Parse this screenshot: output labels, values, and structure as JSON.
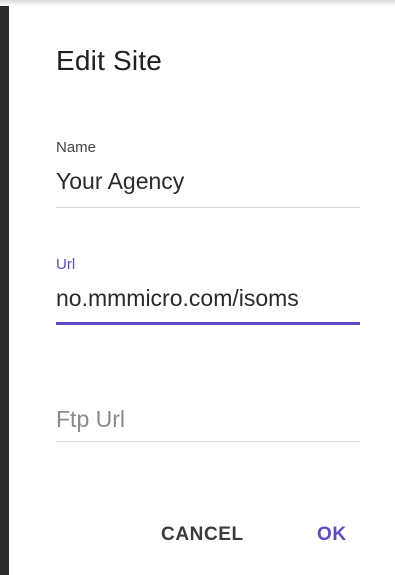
{
  "dialog": {
    "title": "Edit Site",
    "fields": {
      "name": {
        "label": "Name",
        "value": "Your Agency"
      },
      "url": {
        "label": "Url",
        "value": "no.mmmicro.com/isoms"
      },
      "ftp_url": {
        "placeholder": "Ftp Url",
        "value": ""
      }
    },
    "buttons": {
      "cancel": "CANCEL",
      "ok": "OK"
    }
  },
  "colors": {
    "accent": "#5b4bc4",
    "text": "#202020",
    "divider": "#d8d8d8"
  }
}
